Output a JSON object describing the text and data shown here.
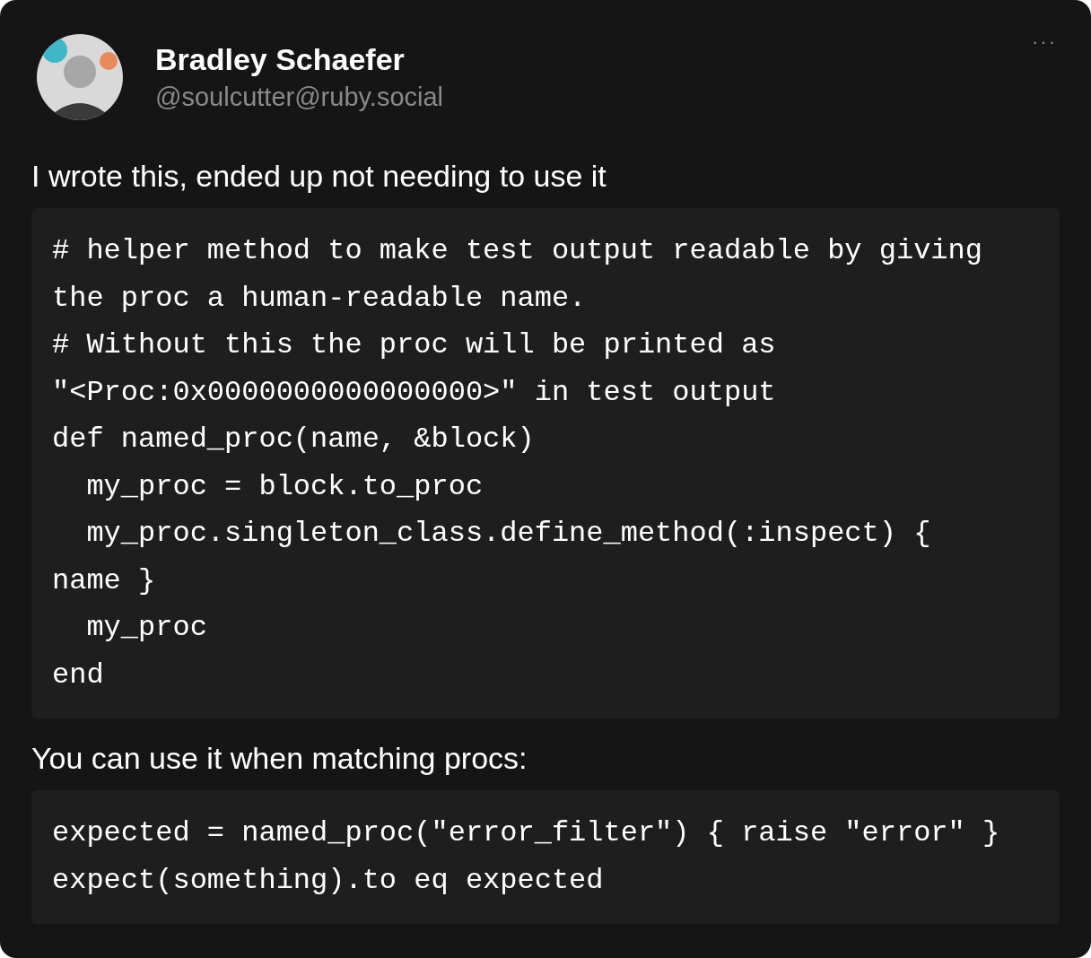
{
  "author": {
    "name": "Bradley Schaefer",
    "handle": "@soulcutter@ruby.social"
  },
  "menu": "···",
  "content": [
    {
      "kind": "paragraph",
      "text": "I wrote this, ended up not needing to use it"
    },
    {
      "kind": "code",
      "lines": [
        "# helper method to make test output readable by giving",
        "the proc a human-readable name.",
        "# Without this the proc will be printed as",
        "\"<Proc:0x0000000000000000>\" in test output",
        "def named_proc(name, &block)",
        "  my_proc = block.to_proc",
        "  my_proc.singleton_class.define_method(:inspect) {",
        "name }",
        "  my_proc",
        "end"
      ]
    },
    {
      "kind": "paragraph",
      "text": "You can use it when matching procs:"
    },
    {
      "kind": "code",
      "lines": [
        "expected = named_proc(\"error_filter\") { raise \"error\" }",
        "expect(something).to eq expected"
      ]
    }
  ]
}
